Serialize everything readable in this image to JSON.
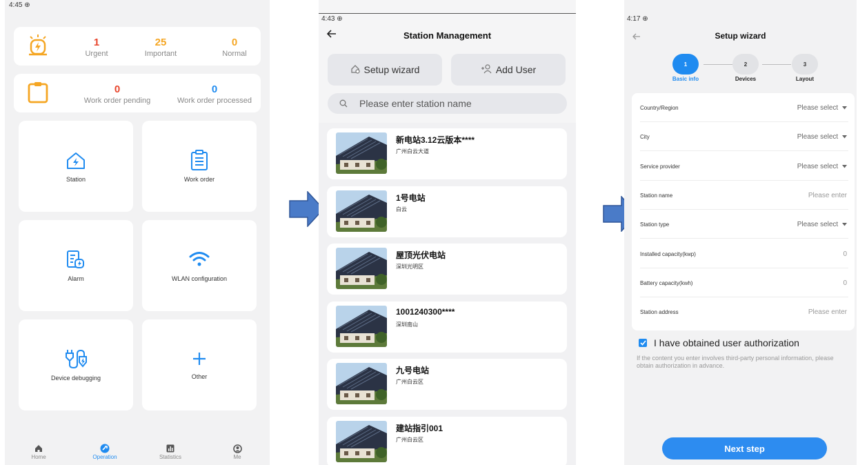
{
  "screen1": {
    "time": "4:45 ⊕",
    "alarm_counts": [
      {
        "num": "1",
        "label": "Urgent",
        "color": "#e8452c"
      },
      {
        "num": "25",
        "label": "Important",
        "color": "#f5a623"
      },
      {
        "num": "0",
        "label": "Normal",
        "color": "#f5a623"
      }
    ],
    "work_orders": [
      {
        "num": "0",
        "label": "Work order pending",
        "color": "#e8452c"
      },
      {
        "num": "0",
        "label": "Work order processed",
        "color": "#1f8bf0"
      }
    ],
    "tiles": [
      {
        "label": "Station",
        "icon": "station-house-icon"
      },
      {
        "label": "Work order",
        "icon": "clipboard-icon"
      },
      {
        "label": "Alarm",
        "icon": "alarm-document-icon"
      },
      {
        "label": "WLAN configuration",
        "icon": "wifi-icon"
      },
      {
        "label": "Device debugging",
        "icon": "plug-icon"
      },
      {
        "label": "Other",
        "icon": "plus-icon"
      }
    ],
    "nav": [
      {
        "label": "Home",
        "icon": "home-icon",
        "active": false
      },
      {
        "label": "Operation",
        "icon": "operation-icon",
        "active": true
      },
      {
        "label": "Statistics",
        "icon": "statistics-icon",
        "active": false
      },
      {
        "label": "Me",
        "icon": "person-icon",
        "active": false
      }
    ],
    "accent": "#1f8bf0"
  },
  "screen2": {
    "time": "4:43 ⊕",
    "title": "Station Management",
    "setup_wizard_label": "Setup wizard",
    "add_user_label": "Add User",
    "search_placeholder": "Please enter station name",
    "stations": [
      {
        "name": "新电站3.12云版本****",
        "address": "广州白云大道"
      },
      {
        "name": "1号电站",
        "address": "白云"
      },
      {
        "name": "屋顶光伏电站",
        "address": "深圳光明区"
      },
      {
        "name": "1001240300****",
        "address": "深圳南山"
      },
      {
        "name": "九号电站",
        "address": "广州白云区"
      },
      {
        "name": "建站指引001",
        "address": "广州白云区"
      }
    ]
  },
  "screen3": {
    "time": "4:17 ⊕",
    "title": "Setup wizard",
    "steps": [
      {
        "num": "1",
        "label": "Basic info",
        "active": true
      },
      {
        "num": "2",
        "label": "Devices",
        "active": false
      },
      {
        "num": "3",
        "label": "Layout",
        "active": false
      }
    ],
    "fields": [
      {
        "label": "Country/Region",
        "value": "Please select",
        "dropdown": true
      },
      {
        "label": "City",
        "value": "Please select",
        "dropdown": true
      },
      {
        "label": "Service provider",
        "value": "Please select",
        "dropdown": true
      },
      {
        "label": "Station name",
        "value": "Please enter",
        "dropdown": false
      },
      {
        "label": "Station type",
        "value": "Please select",
        "dropdown": true
      },
      {
        "label": "Installed capacity(kwp)",
        "value": "0",
        "dropdown": false
      },
      {
        "label": "Battery capacity(kwh)",
        "value": "0",
        "dropdown": false
      },
      {
        "label": "Station address",
        "value": "Please enter",
        "dropdown": false
      }
    ],
    "authorization_label": "I have obtained user authorization",
    "authorization_note": "If the content you enter involves third-party personal information, please obtain authorization in advance.",
    "next_label": "Next step"
  },
  "colors": {
    "arrow": "#4a7bc8",
    "arrow_border": "#2f5597"
  }
}
